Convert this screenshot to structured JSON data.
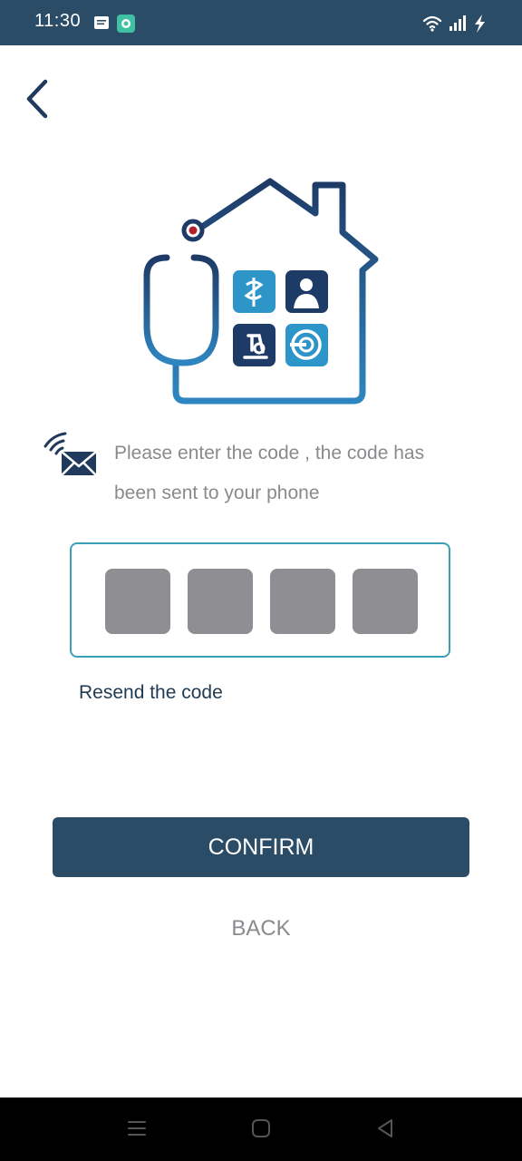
{
  "status_bar": {
    "time": "11:30",
    "left_icons": [
      "message-icon",
      "chat-app-icon"
    ],
    "right_icons": [
      "wifi-icon",
      "signal-icon",
      "charging-icon"
    ]
  },
  "header": {
    "back_icon": "chevron-left-icon"
  },
  "verification": {
    "message": "Please enter the code , the code has been sent to your phone",
    "code_cells": [
      "",
      "",
      "",
      ""
    ],
    "resend_label": "Resend the code"
  },
  "actions": {
    "confirm_label": "CONFIRM",
    "back_label": "BACK"
  },
  "nav_bar": {
    "buttons": [
      "menu-icon",
      "home-icon",
      "back-triangle-icon"
    ]
  },
  "colors": {
    "primary": "#2b4c66",
    "accent": "#3aa0b5",
    "muted_text": "#8a8a8e",
    "code_cell": "#8e8e93"
  }
}
